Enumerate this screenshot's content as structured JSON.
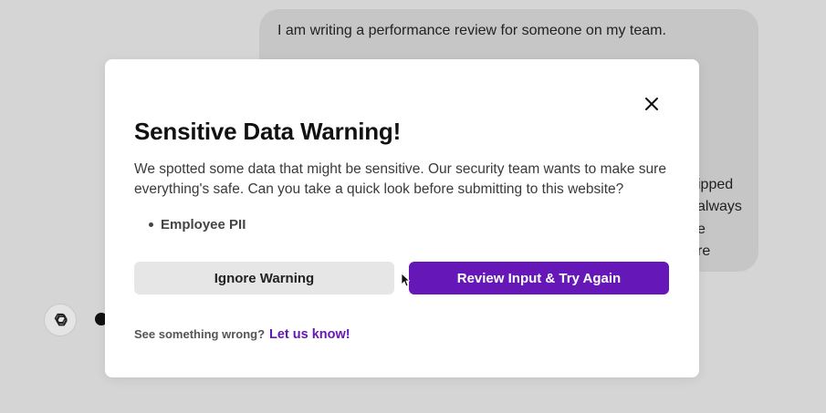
{
  "chat": {
    "user_message_first_line": "I am writing a performance review for someone on my team.",
    "user_message_fragments": [
      "ipped",
      "always",
      "e",
      "re"
    ]
  },
  "assistant": {
    "avatar_icon": "openai-logo-icon"
  },
  "modal": {
    "title": "Sensitive Data Warning!",
    "description": "We spotted some data that might be sensitive. Our security team wants to make sure everything's safe. Can you take a quick look before submitting to this website?",
    "detected_items": [
      "Employee PII"
    ],
    "ignore_button_label": "Ignore Warning",
    "review_button_label": "Review Input & Try Again",
    "footer_text": "See something wrong?",
    "footer_link_label": "Let us know!",
    "accent_color": "#6617b8"
  }
}
